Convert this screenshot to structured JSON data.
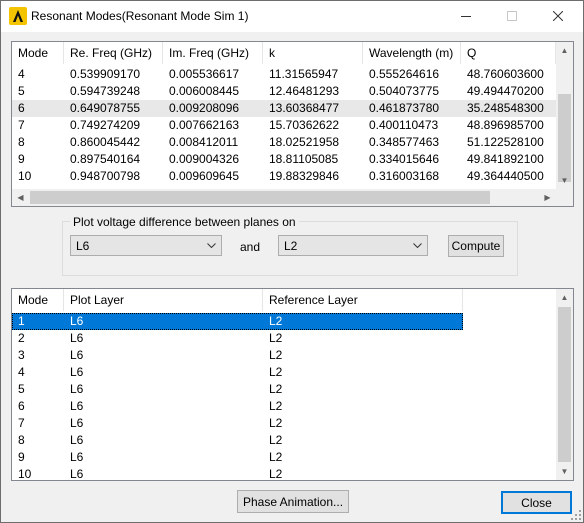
{
  "window": {
    "title": "Resonant Modes(Resonant Mode Sim 1)"
  },
  "modes_table": {
    "columns": [
      "Mode",
      "Re. Freq (GHz)",
      "Im. Freq (GHz)",
      "k",
      "Wavelength (m)",
      "Q"
    ],
    "rows": [
      [
        "4",
        "0.539909170",
        "0.005536617",
        "11.31565947",
        "0.555264616",
        "48.760603600"
      ],
      [
        "5",
        "0.594739248",
        "0.006008445",
        "12.46481293",
        "0.504073775",
        "49.494470200"
      ],
      [
        "6",
        "0.649078755",
        "0.009208096",
        "13.60368477",
        "0.461873780",
        "35.248548300"
      ],
      [
        "7",
        "0.749274209",
        "0.007662163",
        "15.70362622",
        "0.400110473",
        "48.896985700"
      ],
      [
        "8",
        "0.860045442",
        "0.008412011",
        "18.02521958",
        "0.348577463",
        "51.122528100"
      ],
      [
        "9",
        "0.897540164",
        "0.009004326",
        "18.81105085",
        "0.334015646",
        "49.841892100"
      ],
      [
        "10",
        "0.948700798",
        "0.009609645",
        "19.88329846",
        "0.316003168",
        "49.364440500"
      ]
    ],
    "highlighted_row": 2
  },
  "plot_group": {
    "label": "Plot voltage difference between planes on",
    "plot_layer": "L6",
    "and_label": "and",
    "reference_layer": "L2",
    "compute_label": "Compute"
  },
  "layers_table": {
    "columns": [
      "Mode",
      "Plot Layer",
      "Reference Layer"
    ],
    "rows": [
      [
        "1",
        "L6",
        "L2"
      ],
      [
        "2",
        "L6",
        "L2"
      ],
      [
        "3",
        "L6",
        "L2"
      ],
      [
        "4",
        "L6",
        "L2"
      ],
      [
        "5",
        "L6",
        "L2"
      ],
      [
        "6",
        "L6",
        "L2"
      ],
      [
        "7",
        "L6",
        "L2"
      ],
      [
        "8",
        "L6",
        "L2"
      ],
      [
        "9",
        "L6",
        "L2"
      ],
      [
        "10",
        "L6",
        "L2"
      ]
    ],
    "selected_row": 0
  },
  "footer": {
    "phase_animation_label": "Phase Animation...",
    "close_label": "Close"
  },
  "colors": {
    "selection": "#0078d7",
    "accent_border": "#0078d7"
  }
}
